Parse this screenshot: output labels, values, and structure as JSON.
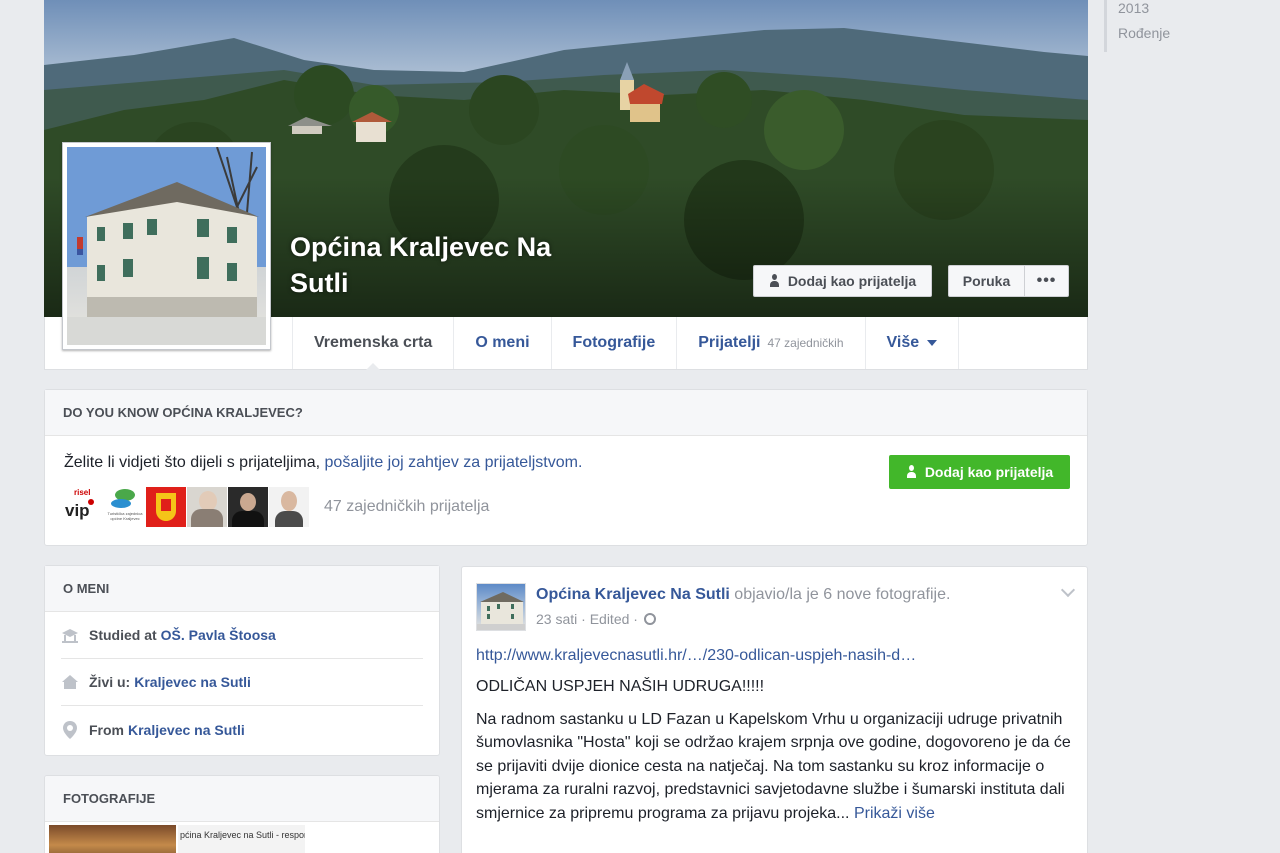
{
  "year_nav": {
    "items": [
      "2013",
      "Rođenje"
    ]
  },
  "profile": {
    "name": "Općina Kraljevec Na Sutli",
    "add_friend_label": "Dodaj kao prijatelja",
    "message_label": "Poruka",
    "more_label": "•••"
  },
  "tabs": [
    {
      "label": "Vremenska crta"
    },
    {
      "label": "O meni"
    },
    {
      "label": "Fotografije"
    },
    {
      "label": "Prijatelji",
      "count": "47 zajedničkih"
    },
    {
      "label": "Više"
    }
  ],
  "know_box": {
    "title": "DO YOU KNOW OPĆINA KRALJEVEC?",
    "text_prefix": "Želite li vidjeti što dijeli s prijateljima, ",
    "text_link": "pošaljite joj zahtjev za prijateljstvom.",
    "add_friend_label": "Dodaj kao prijatelja",
    "mutual_friends": "47 zajedničkih prijatelja",
    "thumb_texts": [
      "risel",
      "vip",
      "Turistička zajednica općine Kraljevec"
    ]
  },
  "about": {
    "title": "O MENI",
    "studied_prefix": "Studied at",
    "studied_link": "OŠ. Pavla Štoosa",
    "lives_prefix": "Živi u:",
    "lives_link": "Kraljevec na Sutli",
    "from_prefix": "From",
    "from_link": "Kraljevec na Sutli"
  },
  "photos": {
    "title": "FOTOGRAFIJE",
    "thumb_caption": "pćina Kraljevec na Sutli - respons"
  },
  "post": {
    "author": "Općina Kraljevec Na Sutli",
    "action": " objavio/la je 6 nove fotografije.",
    "time": "23 sati · Edited · ",
    "link": "http://www.kraljevecnasutli.hr/…/230-odlican-uspjeh-nasih-d…",
    "headline": "ODLIČAN USPJEH NAŠIH UDRUGA!!!!!",
    "body": "Na radnom sastanku u LD Fazan u Kapelskom Vrhu u organizaciji udruge privatnih šumovlasnika \"Hosta\" koji se održao krajem srpnja ove godine, dogovoreno je da će se prijaviti dvije dionice cesta na natječaj. Na tom sastanku su kroz informacije o mjerama za ruralni razvoj, predstavnici savjetodavne službe i šumarski instituta dali smjernice za pripremu programa za prijavu projeka... ",
    "see_more": "Prikaži više"
  }
}
